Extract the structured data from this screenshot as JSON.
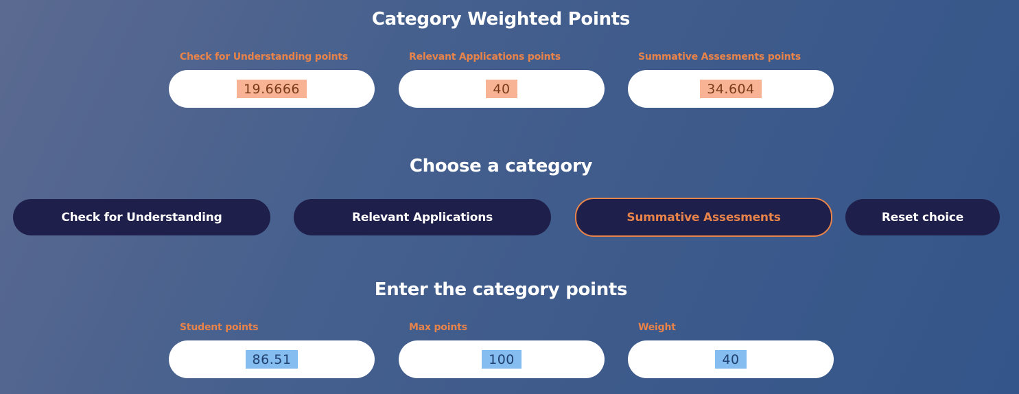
{
  "weighted": {
    "title": "Category Weighted Points",
    "fields": [
      {
        "label": "Check for Understanding points",
        "value": "19.6666"
      },
      {
        "label": "Relevant Applications points",
        "value": "40"
      },
      {
        "label": "Summative Assesments points",
        "value": "34.604"
      }
    ]
  },
  "choose": {
    "title": "Choose a category",
    "buttons": [
      {
        "label": "Check for Understanding",
        "selected": false
      },
      {
        "label": "Relevant Applications",
        "selected": false
      },
      {
        "label": "Summative Assesments",
        "selected": true
      },
      {
        "label": "Reset choice",
        "selected": false
      }
    ]
  },
  "entry": {
    "title": "Enter the category points",
    "fields": [
      {
        "label": "Student points",
        "value": "86.51"
      },
      {
        "label": "Max points",
        "value": "100"
      },
      {
        "label": "Weight",
        "value": "40"
      }
    ]
  },
  "colors": {
    "accent": "#e8834a",
    "button_bg": "#1f1f4b",
    "output_highlight": "#f7b394",
    "input_highlight": "#86bdf0"
  }
}
